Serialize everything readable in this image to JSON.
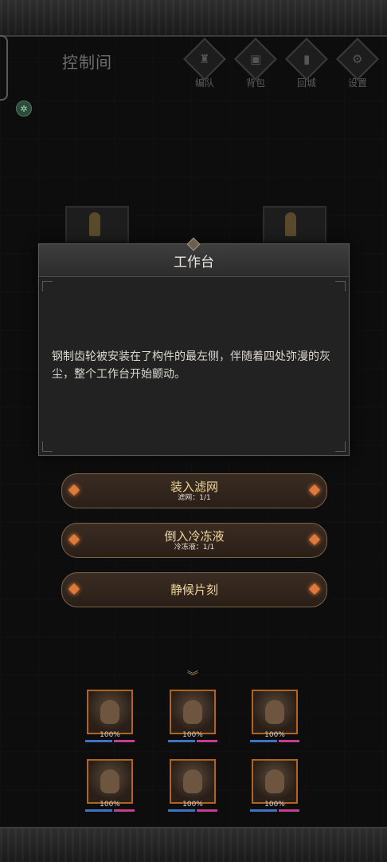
{
  "room": {
    "title": "控制间"
  },
  "nav": [
    {
      "label": "编队",
      "icon": "helmet-icon"
    },
    {
      "label": "背包",
      "icon": "bag-icon"
    },
    {
      "label": "回城",
      "icon": "door-icon"
    },
    {
      "label": "设置",
      "icon": "gear-icon"
    }
  ],
  "dialog": {
    "title": "工作台",
    "text": "钢制齿轮被安装在了构件的最左侧，伴随着四处弥漫的灰尘，整个工作台开始颤动。"
  },
  "actions": [
    {
      "label": "装入滤网",
      "sub": "滤网：1/1"
    },
    {
      "label": "倒入冷冻液",
      "sub": "冷冻液：1/1"
    },
    {
      "label": "静候片刻",
      "sub": ""
    }
  ],
  "party": [
    {
      "hp_percent": "100%"
    },
    {
      "hp_percent": "100%"
    },
    {
      "hp_percent": "100%"
    },
    {
      "hp_percent": "100%"
    },
    {
      "hp_percent": "100%"
    },
    {
      "hp_percent": "100%"
    }
  ],
  "colors": {
    "accent_gold": "#efd79a",
    "gem_orange": "#e07a3a",
    "hp_blue": "#3f72c2",
    "sp_pink": "#c23f8e"
  }
}
